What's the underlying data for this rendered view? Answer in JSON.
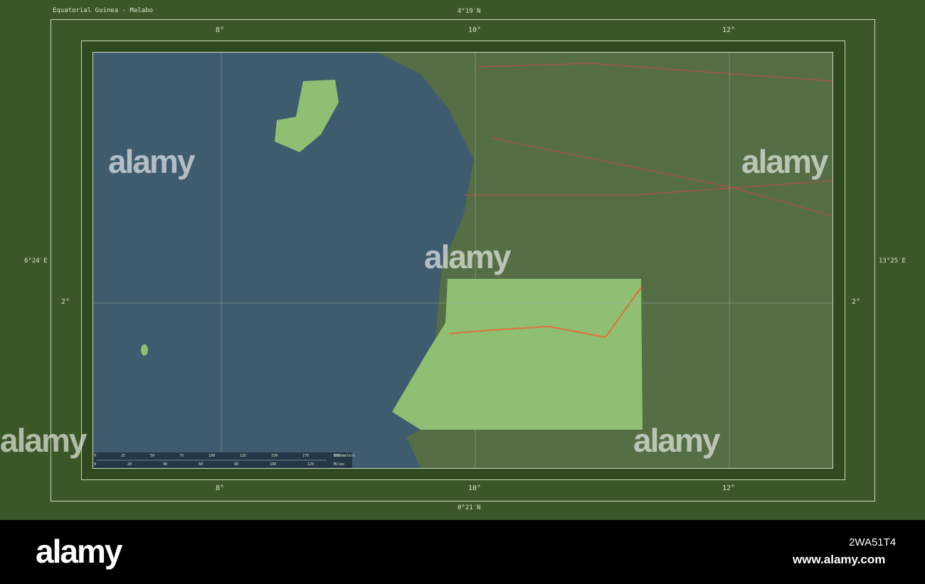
{
  "title": "Equatorial Guinea - Malabo",
  "coords": {
    "top": "4°19′N",
    "bottom": "0°21′N",
    "left": "6°24′E",
    "right": "13°25′E"
  },
  "lon_ticks": [
    "8°",
    "10°",
    "12°"
  ],
  "lat_ticks": [
    "2°"
  ],
  "scale": {
    "km_ticks": [
      "0",
      "25",
      "50",
      "75",
      "100",
      "125",
      "150",
      "175",
      "200"
    ],
    "km_unit": "Kilometers",
    "mi_ticks": [
      "0",
      "20",
      "40",
      "60",
      "80",
      "100",
      "120"
    ],
    "mi_unit": "Miles"
  },
  "watermark": "alamy",
  "footer": {
    "logo": "alamy",
    "code": "2WA51T4",
    "url": "www.alamy.com"
  },
  "colors": {
    "sea": "#3f5b6e",
    "land": "#556e46",
    "country": "#8fbf72",
    "frame": "#3b5727"
  }
}
